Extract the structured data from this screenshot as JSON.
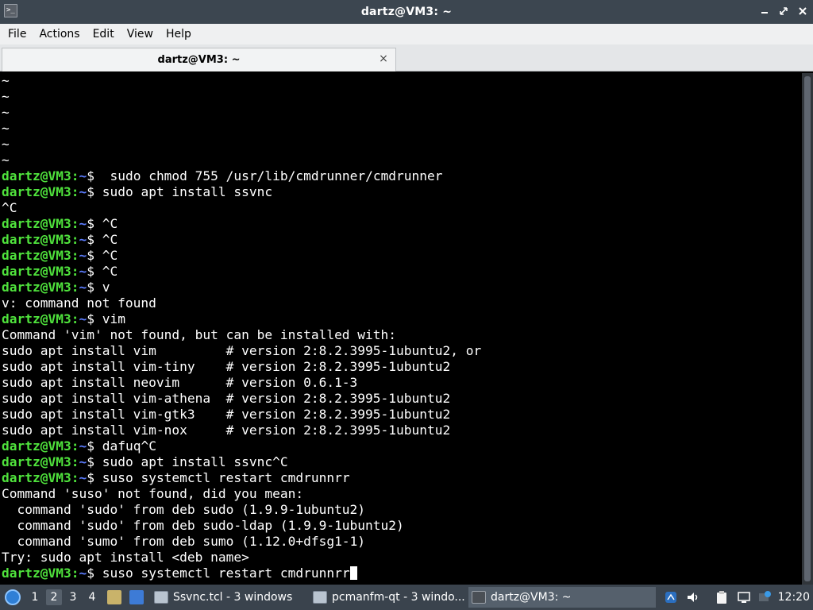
{
  "window": {
    "title": "dartz@VM3: ~",
    "terminal_icon": ">_"
  },
  "menu": [
    "File",
    "Actions",
    "Edit",
    "View",
    "Help"
  ],
  "tab": {
    "label": "dartz@VM3: ~",
    "close": "×"
  },
  "terminal": {
    "prompt_user": "dartz@VM3",
    "prompt_sep": ":",
    "prompt_path": "~",
    "prompt_end": "$ ",
    "lines": [
      {
        "text": "~"
      },
      {
        "text": "~"
      },
      {
        "text": "~"
      },
      {
        "text": "~"
      },
      {
        "text": "~"
      },
      {
        "text": "~"
      },
      {
        "prompt": true,
        "text": " sudo chmod 755 /usr/lib/cmdrunner/cmdrunner"
      },
      {
        "prompt": true,
        "text": "sudo apt install ssvnc"
      },
      {
        "text": "^C"
      },
      {
        "prompt": true,
        "text": "^C"
      },
      {
        "prompt": true,
        "text": "^C"
      },
      {
        "prompt": true,
        "text": "^C"
      },
      {
        "prompt": true,
        "text": "^C"
      },
      {
        "prompt": true,
        "text": "v"
      },
      {
        "text": "v: command not found"
      },
      {
        "prompt": true,
        "text": "vim"
      },
      {
        "text": "Command 'vim' not found, but can be installed with:"
      },
      {
        "text": "sudo apt install vim         # version 2:8.2.3995-1ubuntu2, or"
      },
      {
        "text": "sudo apt install vim-tiny    # version 2:8.2.3995-1ubuntu2"
      },
      {
        "text": "sudo apt install neovim      # version 0.6.1-3"
      },
      {
        "text": "sudo apt install vim-athena  # version 2:8.2.3995-1ubuntu2"
      },
      {
        "text": "sudo apt install vim-gtk3    # version 2:8.2.3995-1ubuntu2"
      },
      {
        "text": "sudo apt install vim-nox     # version 2:8.2.3995-1ubuntu2"
      },
      {
        "prompt": true,
        "text": "dafuq^C"
      },
      {
        "prompt": true,
        "text": "sudo apt install ssvnc^C"
      },
      {
        "prompt": true,
        "text": "suso systemctl restart cmdrunnrr"
      },
      {
        "text": "Command 'suso' not found, did you mean:"
      },
      {
        "text": "  command 'sudo' from deb sudo (1.9.9-1ubuntu2)"
      },
      {
        "text": "  command 'sudo' from deb sudo-ldap (1.9.9-1ubuntu2)"
      },
      {
        "text": "  command 'sumo' from deb sumo (1.12.0+dfsg1-1)"
      },
      {
        "text": "Try: sudo apt install <deb name>"
      },
      {
        "prompt": true,
        "text": "suso systemctl restart cmdrunnrr",
        "cursor": true
      }
    ]
  },
  "taskbar": {
    "workspaces": [
      "1",
      "2",
      "3",
      "4"
    ],
    "active_workspace": "2",
    "tasks": [
      {
        "label": "Ssvnc.tcl - 3 windows",
        "icon": "window-icon"
      },
      {
        "label": "pcmanfm-qt - 3 windo...",
        "icon": "window-icon"
      },
      {
        "label": "dartz@VM3: ~",
        "icon": "terminal-icon"
      }
    ],
    "clock": "12:20"
  },
  "colors": {
    "prompt_user": "#4fe23c",
    "prompt_path": "#5c7dff",
    "terminal_bg": "#000000",
    "titlebar_bg": "#3c4650",
    "taskbar_bg": "#3a434d"
  }
}
